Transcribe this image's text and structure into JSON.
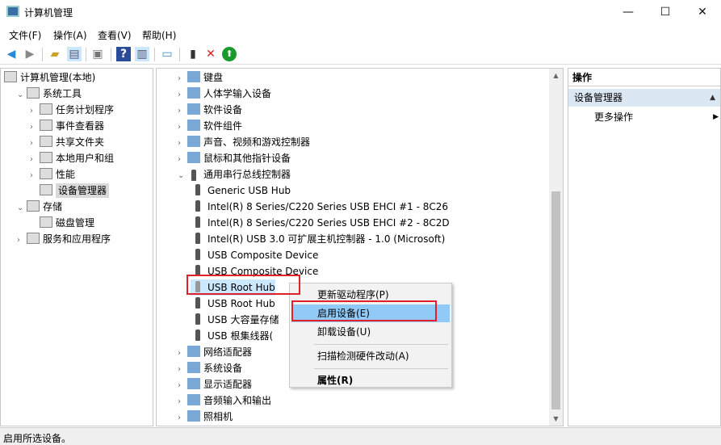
{
  "window": {
    "title": "计算机管理",
    "minimize": "—",
    "maximize": "☐",
    "close": "✕"
  },
  "menu": [
    "文件(F)",
    "操作(A)",
    "查看(V)",
    "帮助(H)"
  ],
  "toolbar": [
    "back-arrow-icon",
    "forward-arrow-icon",
    "up-folder-icon",
    "show-hide-tree-icon",
    "properties-icon",
    "help-icon",
    "action-pane-icon",
    "monitor-icon",
    "update-driver-icon",
    "uninstall-icon",
    "enable-icon"
  ],
  "left_tree": [
    {
      "label": "计算机管理(本地)",
      "level": 0,
      "chev": ""
    },
    {
      "label": "系统工具",
      "level": 1,
      "chev": "v"
    },
    {
      "label": "任务计划程序",
      "level": 2,
      "chev": ">"
    },
    {
      "label": "事件查看器",
      "level": 2,
      "chev": ">"
    },
    {
      "label": "共享文件夹",
      "level": 2,
      "chev": ">"
    },
    {
      "label": "本地用户和组",
      "level": 2,
      "chev": ">"
    },
    {
      "label": "性能",
      "level": 2,
      "chev": ">"
    },
    {
      "label": "设备管理器",
      "level": 2,
      "chev": "",
      "selected": true
    },
    {
      "label": "存储",
      "level": 1,
      "chev": "v"
    },
    {
      "label": "磁盘管理",
      "level": 2,
      "chev": ""
    },
    {
      "label": "服务和应用程序",
      "level": 1,
      "chev": ">"
    }
  ],
  "device_tree": [
    {
      "label": "键盘",
      "level": 0,
      "chev": ">",
      "icon": "keyboard-icon"
    },
    {
      "label": "人体学输入设备",
      "level": 0,
      "chev": ">",
      "icon": "hid-icon"
    },
    {
      "label": "软件设备",
      "level": 0,
      "chev": ">",
      "icon": "software-device-icon"
    },
    {
      "label": "软件组件",
      "level": 0,
      "chev": ">",
      "icon": "software-component-icon"
    },
    {
      "label": "声音、视频和游戏控制器",
      "level": 0,
      "chev": ">",
      "icon": "speaker-icon"
    },
    {
      "label": "鼠标和其他指针设备",
      "level": 0,
      "chev": ">",
      "icon": "mouse-icon"
    },
    {
      "label": "通用串行总线控制器",
      "level": 0,
      "chev": "v",
      "icon": "usb-icon"
    },
    {
      "label": "Generic USB Hub",
      "level": 1,
      "icon": "usb-icon"
    },
    {
      "label": "Intel(R) 8 Series/C220 Series USB EHCI #1 - 8C26",
      "level": 1,
      "icon": "usb-icon"
    },
    {
      "label": "Intel(R) 8 Series/C220 Series USB EHCI #2 - 8C2D",
      "level": 1,
      "icon": "usb-icon"
    },
    {
      "label": "Intel(R) USB 3.0 可扩展主机控制器 - 1.0 (Microsoft)",
      "level": 1,
      "icon": "usb-icon"
    },
    {
      "label": "USB Composite Device",
      "level": 1,
      "icon": "usb-icon"
    },
    {
      "label": "USB Composite Device",
      "level": 1,
      "icon": "usb-icon"
    },
    {
      "label": "USB Root Hub",
      "level": 1,
      "icon": "usb-disabled-icon",
      "highlight": true
    },
    {
      "label": "USB Root Hub",
      "level": 1,
      "icon": "usb-icon"
    },
    {
      "label": "USB 大容量存储",
      "level": 1,
      "icon": "usb-icon"
    },
    {
      "label": "USB 根集线器(",
      "level": 1,
      "icon": "usb-icon"
    },
    {
      "label": "网络适配器",
      "level": 0,
      "chev": ">",
      "icon": "network-icon"
    },
    {
      "label": "系统设备",
      "level": 0,
      "chev": ">",
      "icon": "system-device-icon"
    },
    {
      "label": "显示适配器",
      "level": 0,
      "chev": ">",
      "icon": "display-icon"
    },
    {
      "label": "音频输入和输出",
      "level": 0,
      "chev": ">",
      "icon": "audio-icon"
    },
    {
      "label": "照相机",
      "level": 0,
      "chev": ">",
      "icon": "camera-icon"
    }
  ],
  "actions": {
    "header": "操作",
    "section": "设备管理器",
    "more": "更多操作"
  },
  "context_menu": [
    {
      "label": "更新驱动程序(P)"
    },
    {
      "label": "启用设备(E)",
      "active": true
    },
    {
      "label": "卸载设备(U)"
    },
    {
      "label": "扫描检测硬件改动(A)",
      "sep_before": true
    },
    {
      "label": "属性(R)",
      "bold": true,
      "sep_before": true
    }
  ],
  "status": "启用所选设备。",
  "colors": {
    "highlight": "#cce8ff",
    "menu_active": "#91c9f7",
    "red_box": "#e0202a",
    "action_header": "#dbe7f3"
  }
}
